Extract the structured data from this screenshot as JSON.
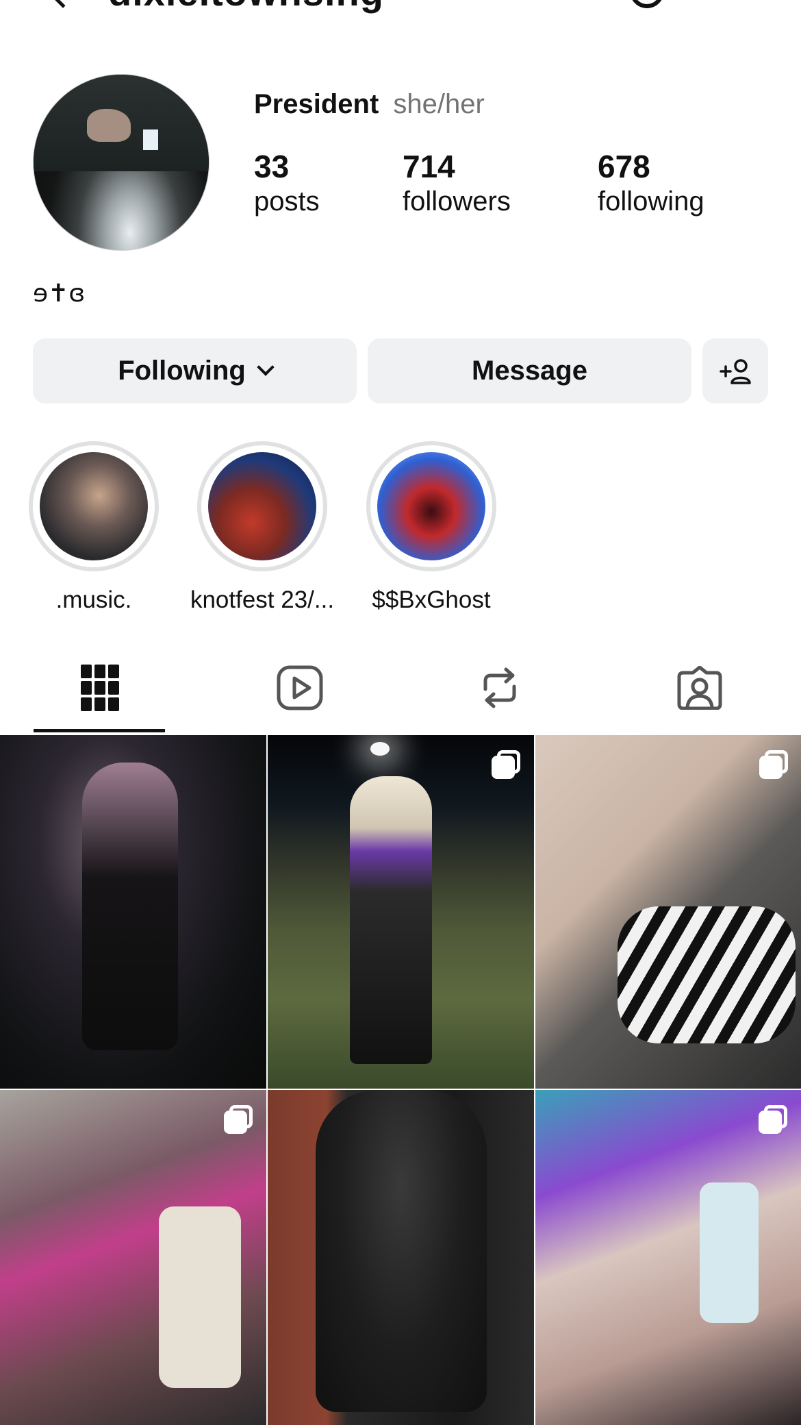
{
  "header": {
    "handle": "dixie.townsing",
    "back_icon": "chevron-left-icon",
    "threads_icon": "threads-icon"
  },
  "profile": {
    "display_name": "President",
    "pronouns": "she/her",
    "stats": {
      "posts": {
        "value": "33",
        "label": "posts"
      },
      "followers": {
        "value": "714",
        "label": "followers"
      },
      "following": {
        "value": "678",
        "label": "following"
      }
    },
    "bio": "ɘ✝ɞ"
  },
  "actions": {
    "following_label": "Following",
    "message_label": "Message",
    "add_user_icon": "add-person-icon"
  },
  "highlights": [
    {
      "label": ".music."
    },
    {
      "label": "knotfest 23/..."
    },
    {
      "label": "$$BxGhost"
    }
  ],
  "tabs": [
    {
      "icon": "grid-icon",
      "active": true
    },
    {
      "icon": "reels-icon",
      "active": false
    },
    {
      "icon": "reposts-icon",
      "active": false
    },
    {
      "icon": "tagged-icon",
      "active": false
    }
  ],
  "posts": [
    {
      "multi": false
    },
    {
      "multi": true
    },
    {
      "multi": true
    },
    {
      "multi": true
    },
    {
      "multi": false
    },
    {
      "multi": true
    }
  ],
  "colors": {
    "button_bg": "#eff1f3",
    "secondary_text": "#737373",
    "highlight_ring": "#dfe1e3",
    "text": "#111111"
  }
}
